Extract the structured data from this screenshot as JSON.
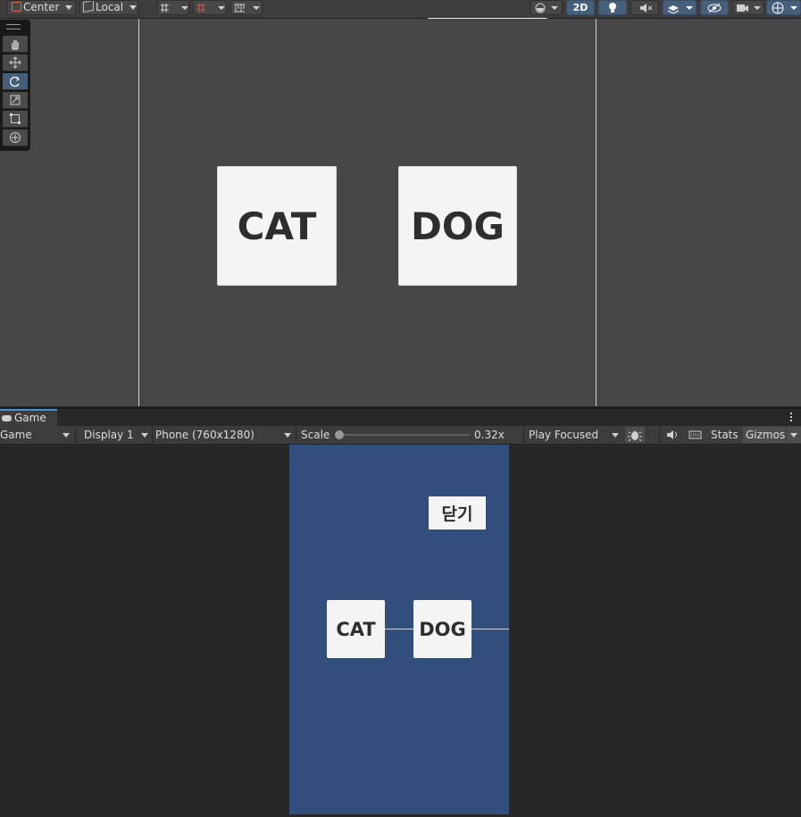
{
  "scene_toolbar": {
    "pivot_label": "Center",
    "space_label": "Local",
    "mode_2d_label": "2D"
  },
  "scene": {
    "cards": [
      {
        "label": "CAT"
      },
      {
        "label": "DOG"
      }
    ]
  },
  "game_panel": {
    "tab_label": "Game",
    "view_dropdown": "Game",
    "display_dropdown": "Display 1",
    "resolution_dropdown": "Phone (760x1280)",
    "scale_label": "Scale",
    "scale_value": "0.32x",
    "scale_fraction": 0.0,
    "play_mode_dropdown": "Play Focused",
    "stats_label": "Stats",
    "gizmos_label": "Gizmos"
  },
  "game_view": {
    "close_button_label": "닫기",
    "cards": [
      {
        "label": "CAT"
      },
      {
        "label": "DOG"
      }
    ],
    "phone_color": "#314e7c"
  },
  "colors": {
    "accent_active": "#46607c",
    "scene_bg": "#474747",
    "game_bg": "#272727"
  },
  "icons": [
    "hand-icon",
    "move-icon",
    "rotate-icon",
    "scale-icon",
    "rect-tool-icon",
    "transform-icon",
    "lightbulb-icon",
    "audio-mute-icon",
    "effects-icon",
    "visibility-icon",
    "camera-icon",
    "gizmos-globe-icon",
    "gamepad-icon",
    "bug-icon",
    "speaker-icon",
    "keyboard-icon",
    "kebab-menu-icon"
  ]
}
